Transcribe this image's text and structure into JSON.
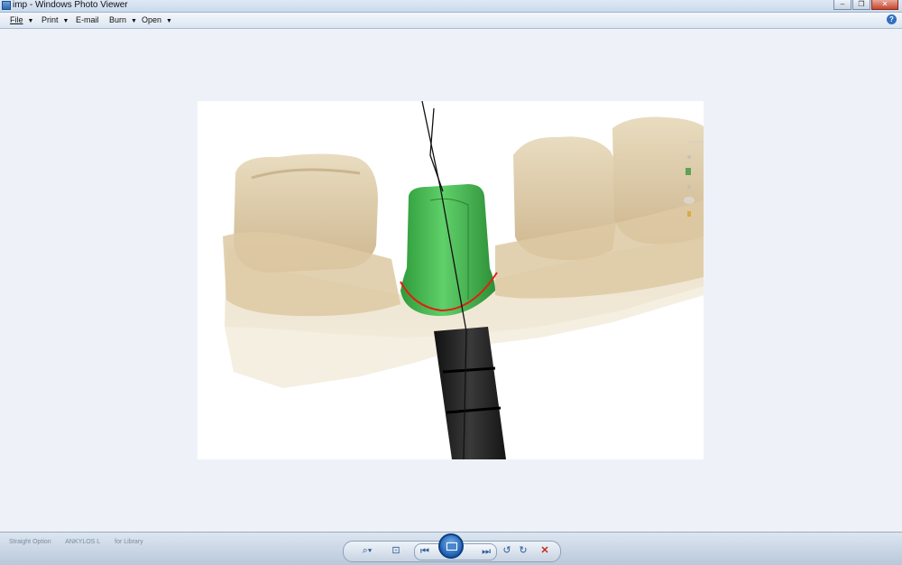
{
  "window": {
    "title": "imp - Windows Photo Viewer",
    "controls": [
      "minimize",
      "restore",
      "close"
    ]
  },
  "menu": {
    "items": [
      {
        "label": "File",
        "has_dropdown": true
      },
      {
        "label": "Print",
        "has_dropdown": true
      },
      {
        "label": "E-mail",
        "has_dropdown": false
      },
      {
        "label": "Burn",
        "has_dropdown": true
      },
      {
        "label": "Open",
        "has_dropdown": true
      }
    ],
    "help_label": "?"
  },
  "photo": {
    "subject": "3D dental model with green abutment",
    "background_color": "#ffffff",
    "abutment_color": "#3fb44a",
    "margin_line_color": "#e02010",
    "tooth_color": "#e3d2b1"
  },
  "bottombar": {
    "thumbnails": [
      "Straight Option",
      "ANKYLOS L",
      "for Library"
    ],
    "controls": [
      {
        "icon": "zoom-icon",
        "label": "⌕▾"
      },
      {
        "icon": "actual-size-icon",
        "label": "⊡"
      },
      {
        "icon": "previous-icon",
        "label": "⏮"
      },
      {
        "icon": "slideshow-icon",
        "label": ""
      },
      {
        "icon": "next-icon",
        "label": "⏭"
      },
      {
        "icon": "rotate-counterclockwise-icon",
        "label": "↺"
      },
      {
        "icon": "rotate-clockwise-icon",
        "label": "↻"
      },
      {
        "icon": "delete-icon",
        "label": "✕"
      }
    ]
  }
}
